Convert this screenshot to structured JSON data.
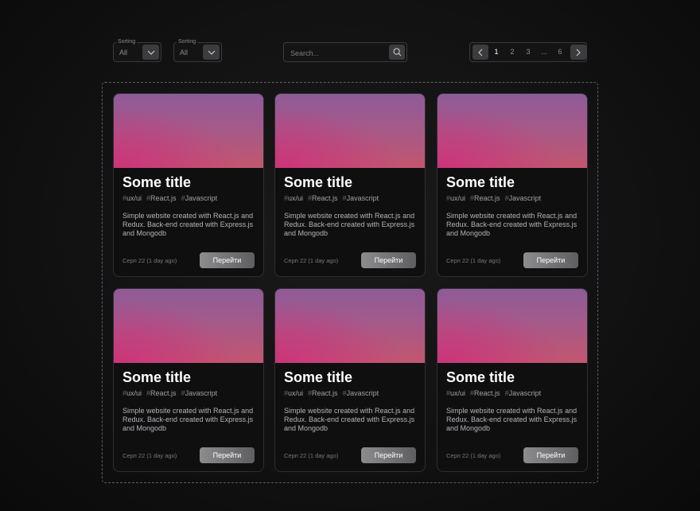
{
  "filters": [
    {
      "legend": "Sorting",
      "value": "All"
    },
    {
      "legend": "Sorting",
      "value": "All"
    }
  ],
  "search": {
    "placeholder": "Search..."
  },
  "pagination": {
    "pages": [
      "1",
      "2",
      "3",
      "...",
      "6"
    ],
    "active": "1"
  },
  "cards": [
    {
      "title": "Some title",
      "tags": [
        "ux/ui",
        "React.js",
        "Javascript"
      ],
      "description": "Simple website created with React.js and Redux. Back-end created with Express.js and Mongodb",
      "date": "Серп 22 (1 day ago)",
      "button": "Перейти"
    },
    {
      "title": "Some title",
      "tags": [
        "ux/ui",
        "React.js",
        "Javascript"
      ],
      "description": "Simple website created with React.js and Redux. Back-end created with Express.js and Mongodb",
      "date": "Серп 22 (1 day ago)",
      "button": "Перейти"
    },
    {
      "title": "Some title",
      "tags": [
        "ux/ui",
        "React.js",
        "Javascript"
      ],
      "description": "Simple website created with React.js and Redux. Back-end created with Express.js and Mongodb",
      "date": "Серп 22 (1 day ago)",
      "button": "Перейти"
    },
    {
      "title": "Some title",
      "tags": [
        "ux/ui",
        "React.js",
        "Javascript"
      ],
      "description": "Simple website created with React.js and Redux. Back-end created with Express.js and Mongodb",
      "date": "Серп 22 (1 day ago)",
      "button": "Перейти"
    },
    {
      "title": "Some title",
      "tags": [
        "ux/ui",
        "React.js",
        "Javascript"
      ],
      "description": "Simple website created with React.js and Redux. Back-end created with Express.js and Mongodb",
      "date": "Серп 22 (1 day ago)",
      "button": "Перейти"
    },
    {
      "title": "Some title",
      "tags": [
        "ux/ui",
        "React.js",
        "Javascript"
      ],
      "description": "Simple website created with React.js and Redux. Back-end created with Express.js and Mongodb",
      "date": "Серп 22 (1 day ago)",
      "button": "Перейти"
    }
  ]
}
